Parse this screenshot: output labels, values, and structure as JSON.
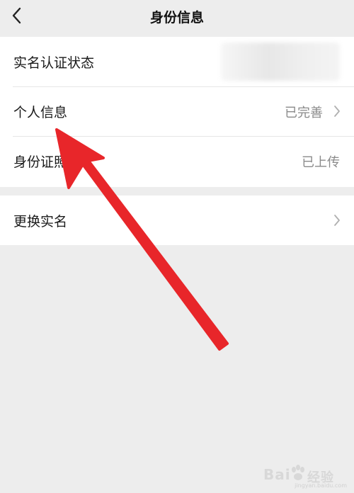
{
  "header": {
    "title": "身份信息",
    "back_icon": "chevron-left-icon"
  },
  "section1": {
    "rows": [
      {
        "label": "实名认证状态",
        "value": ""
      },
      {
        "label": "个人信息",
        "value": "已完善"
      },
      {
        "label": "身份证照",
        "value": "已上传"
      }
    ]
  },
  "section2": {
    "rows": [
      {
        "label": "更换实名"
      }
    ]
  },
  "overlay": {
    "arrow_color": "#e8262a"
  },
  "watermark": {
    "brand": "Bai",
    "suffix": "经验",
    "url": "jingyan.baidu.com"
  },
  "colors": {
    "background": "#ededed",
    "card": "#ffffff",
    "value_text": "#8a8a8a"
  }
}
